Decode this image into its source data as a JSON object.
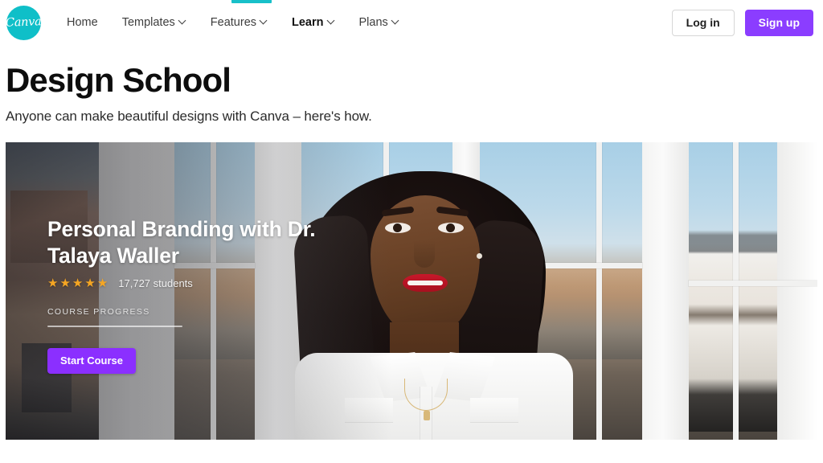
{
  "loading": {
    "accent_color": "#18c0c9",
    "progress_percent": 5
  },
  "header": {
    "logo": {
      "name": "canva-logo",
      "wordmark": "Canva",
      "background_color": "#0fbfc8"
    },
    "nav_items": [
      {
        "label": "Home",
        "has_caret": false,
        "active": false
      },
      {
        "label": "Templates",
        "has_caret": true,
        "active": false
      },
      {
        "label": "Features",
        "has_caret": true,
        "active": false
      },
      {
        "label": "Learn",
        "has_caret": true,
        "active": true
      },
      {
        "label": "Plans",
        "has_caret": true,
        "active": false
      }
    ],
    "login_label": "Log in",
    "signup_label": "Sign up",
    "signup_color": "#8b3dff"
  },
  "page": {
    "title": "Design School",
    "subtitle": "Anyone can make beautiful designs with Canva – here's how."
  },
  "hero": {
    "course_title": "Personal Branding with Dr. Talaya Waller",
    "rating_stars": 5,
    "star_glyph": "★",
    "star_color": "#f5a623",
    "student_count": "17,727 students",
    "progress_label": "COURSE PROGRESS",
    "progress_percent": 0,
    "cta_label": "Start Course",
    "cta_color": "#8b2fff"
  }
}
